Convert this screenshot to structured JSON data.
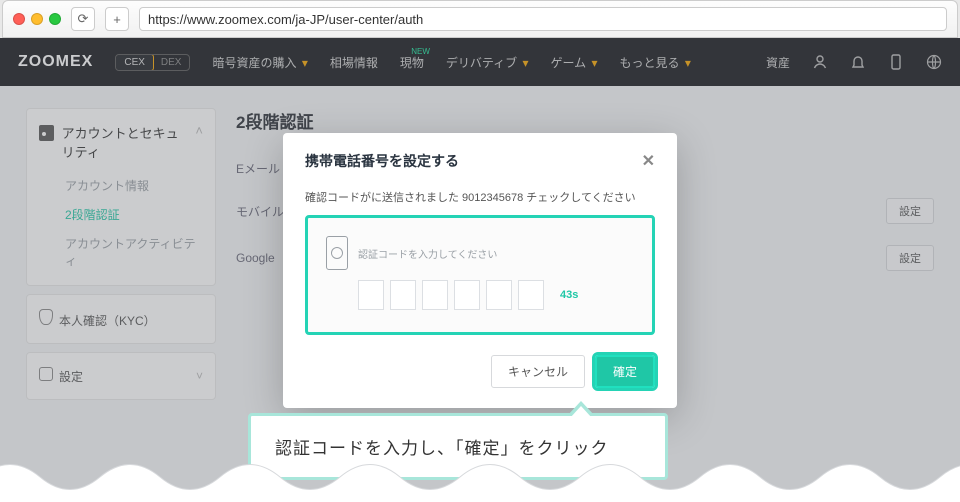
{
  "browser": {
    "url": "https://www.zoomex.com/ja-JP/user-center/auth"
  },
  "nav": {
    "logo": "ZOOMEX",
    "toggle_on": "CEX",
    "toggle_off": "DEX",
    "items": [
      "暗号資産の購入",
      "相場情報",
      "現物",
      "デリバティブ",
      "ゲーム",
      "もっと見る"
    ],
    "new_badge": "NEW",
    "assets": "資産"
  },
  "sidebar": {
    "section_title": "アカウントとセキュリティ",
    "items": [
      "アカウント情報",
      "2段階認証",
      "アカウントアクティビティ"
    ],
    "kyc": "本人確認（KYC）",
    "settings": "設定"
  },
  "main": {
    "title": "2段階認証",
    "rows": {
      "email": "Eメール",
      "mobile": "モバイル",
      "google": "Google"
    },
    "set_btn": "設定"
  },
  "modal": {
    "title": "携帯電話番号を設定する",
    "sub": "確認コードがに送信されました 9012345678 チェックしてください",
    "code_label": "認証コードを入力してください",
    "timer": "43s",
    "cancel": "キャンセル",
    "confirm": "確定"
  },
  "callout": {
    "text": "認証コードを入力し、「確定」をクリック"
  }
}
